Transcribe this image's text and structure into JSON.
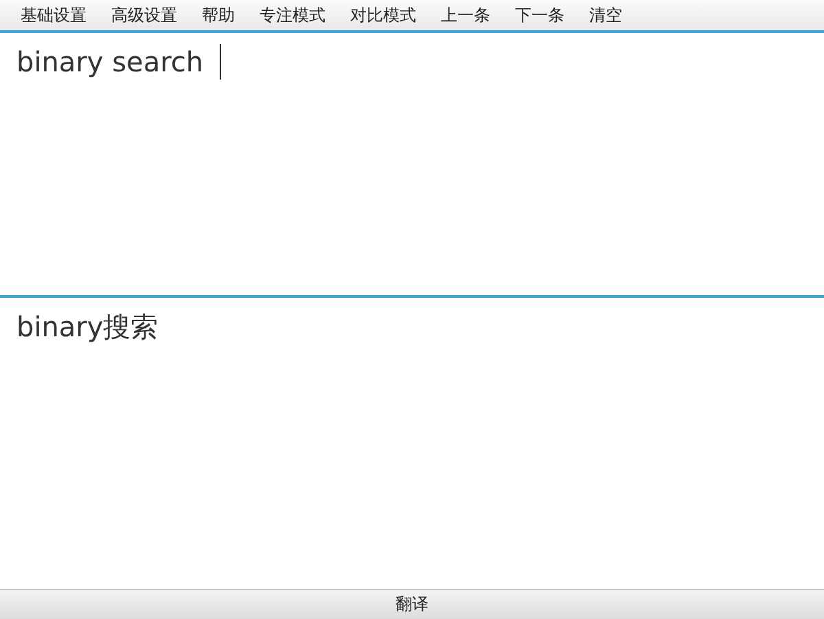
{
  "menu": [
    {
      "label": "基础设置"
    },
    {
      "label": "高级设置"
    },
    {
      "label": "帮助"
    },
    {
      "label": "专注模式"
    },
    {
      "label": "对比模式"
    },
    {
      "label": "上一条"
    },
    {
      "label": "下一条"
    },
    {
      "label": "清空"
    }
  ],
  "source": {
    "value": "binary search"
  },
  "result": {
    "value": "binary搜索"
  },
  "translate_button": {
    "label": "翻译"
  }
}
